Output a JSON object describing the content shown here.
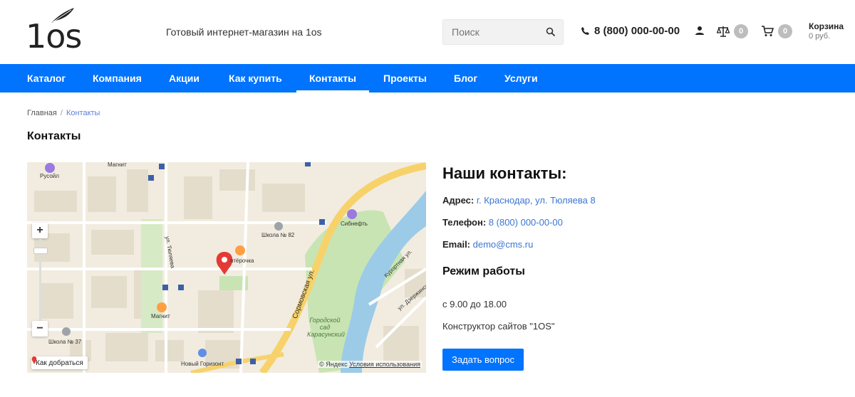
{
  "header": {
    "logo_text": "1os",
    "tagline": "Готовый интернет-магазин на 1os",
    "search": {
      "placeholder": "Поиск"
    },
    "phone": "8 (800) 000-00-00",
    "compare_count": "0",
    "cart_count": "0",
    "cart_title": "Корзина",
    "cart_sum": "0 руб."
  },
  "nav": {
    "items": [
      {
        "label": "Каталог"
      },
      {
        "label": "Компания"
      },
      {
        "label": "Акции"
      },
      {
        "label": "Как купить"
      },
      {
        "label": "Контакты",
        "active": true
      },
      {
        "label": "Проекты"
      },
      {
        "label": "Блог"
      },
      {
        "label": "Услуги"
      }
    ]
  },
  "breadcrumb": {
    "home": "Главная",
    "separator": "/",
    "current": "Контакты"
  },
  "page_title": "Контакты",
  "map": {
    "zoom_in": "+",
    "zoom_out": "−",
    "route_label": "Как добраться",
    "copyright": "© Яндекс",
    "terms": "Условия использования",
    "labels": {
      "rusoil": "Русойл",
      "magnit_top": "Магнит",
      "school82": "Школа № 82",
      "sibneft": "Сибнефть",
      "pyaterochka": "ятёрочка",
      "magnit_bottom": "Магнит",
      "school37": "Школа № 37",
      "new_horizon": "Новый Горизонт",
      "tulyaeva": "ул. Тюляева",
      "sormovskaya": "Сормовская ул.",
      "kurortnaya": "Курортная ул.",
      "dzerzhinsk": "ул. Дзержинск",
      "park": "Городской сад Карасунский"
    },
    "colors": {
      "land": "#f1ecdf",
      "road_main": "#f7d26b",
      "water": "#9ccbe8",
      "park": "#c8e4b3",
      "pin": "#e53935"
    }
  },
  "contacts": {
    "title": "Наши контакты:",
    "address_label": "Адрес:",
    "address": "г. Краснодар, ул. Тюляева 8",
    "phone_label": "Телефон:",
    "phone": "8 (800) 000-00-00",
    "email_label": "Email:",
    "email": "demo@cms.ru",
    "hours_title": "Режим работы",
    "hours": "с 9.00 до 18.00",
    "builder": "Конструктор сайтов \"1OS\"",
    "ask_button": "Задать вопрос"
  },
  "colors": {
    "accent": "#0073ff",
    "link": "#3b76d1"
  }
}
